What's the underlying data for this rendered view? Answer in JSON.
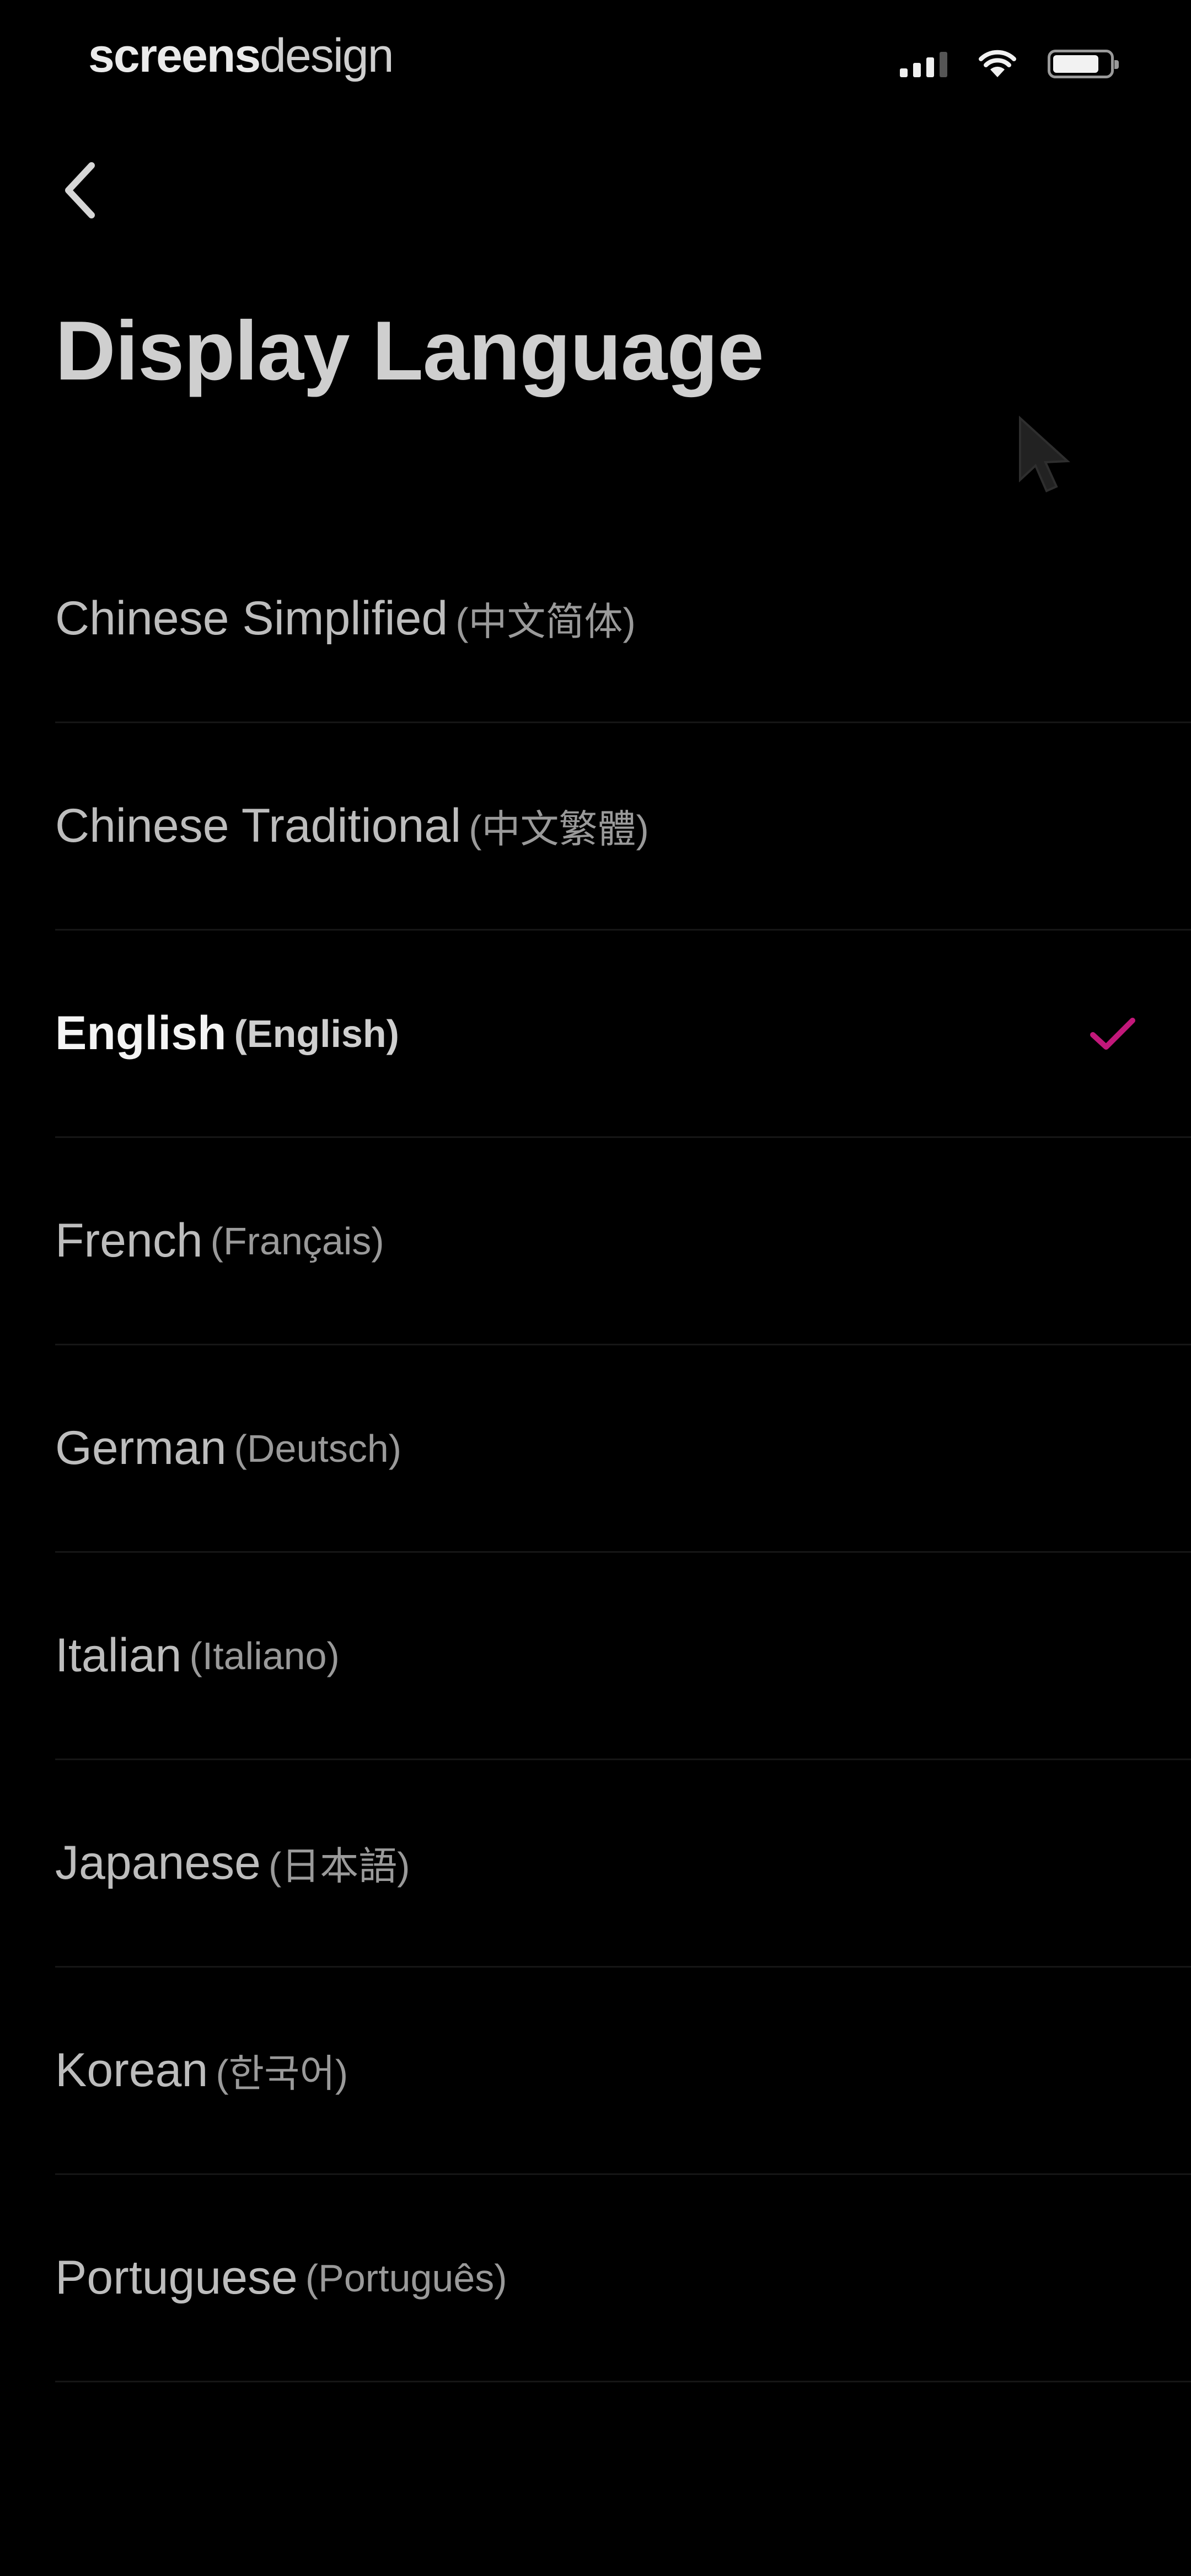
{
  "status_bar": {
    "watermark_bold": "screens",
    "watermark_light": "design"
  },
  "header": {
    "back_icon": "chevron-left-icon",
    "title": "Display Language"
  },
  "colors": {
    "background": "#000000",
    "accent": "#c2187a"
  },
  "languages": [
    {
      "label": "Chinese Simplified",
      "native": "(中文简体)",
      "selected": false
    },
    {
      "label": "Chinese Traditional",
      "native": "(中文繁體)",
      "selected": false
    },
    {
      "label": "English",
      "native": "(English)",
      "selected": true
    },
    {
      "label": "French",
      "native": "(Français)",
      "selected": false
    },
    {
      "label": "German",
      "native": "(Deutsch)",
      "selected": false
    },
    {
      "label": "Italian",
      "native": "(Italiano)",
      "selected": false
    },
    {
      "label": "Japanese",
      "native": "(日本語)",
      "selected": false
    },
    {
      "label": "Korean",
      "native": "(한국어)",
      "selected": false
    },
    {
      "label": "Portuguese",
      "native": "(Português)",
      "selected": false
    }
  ]
}
